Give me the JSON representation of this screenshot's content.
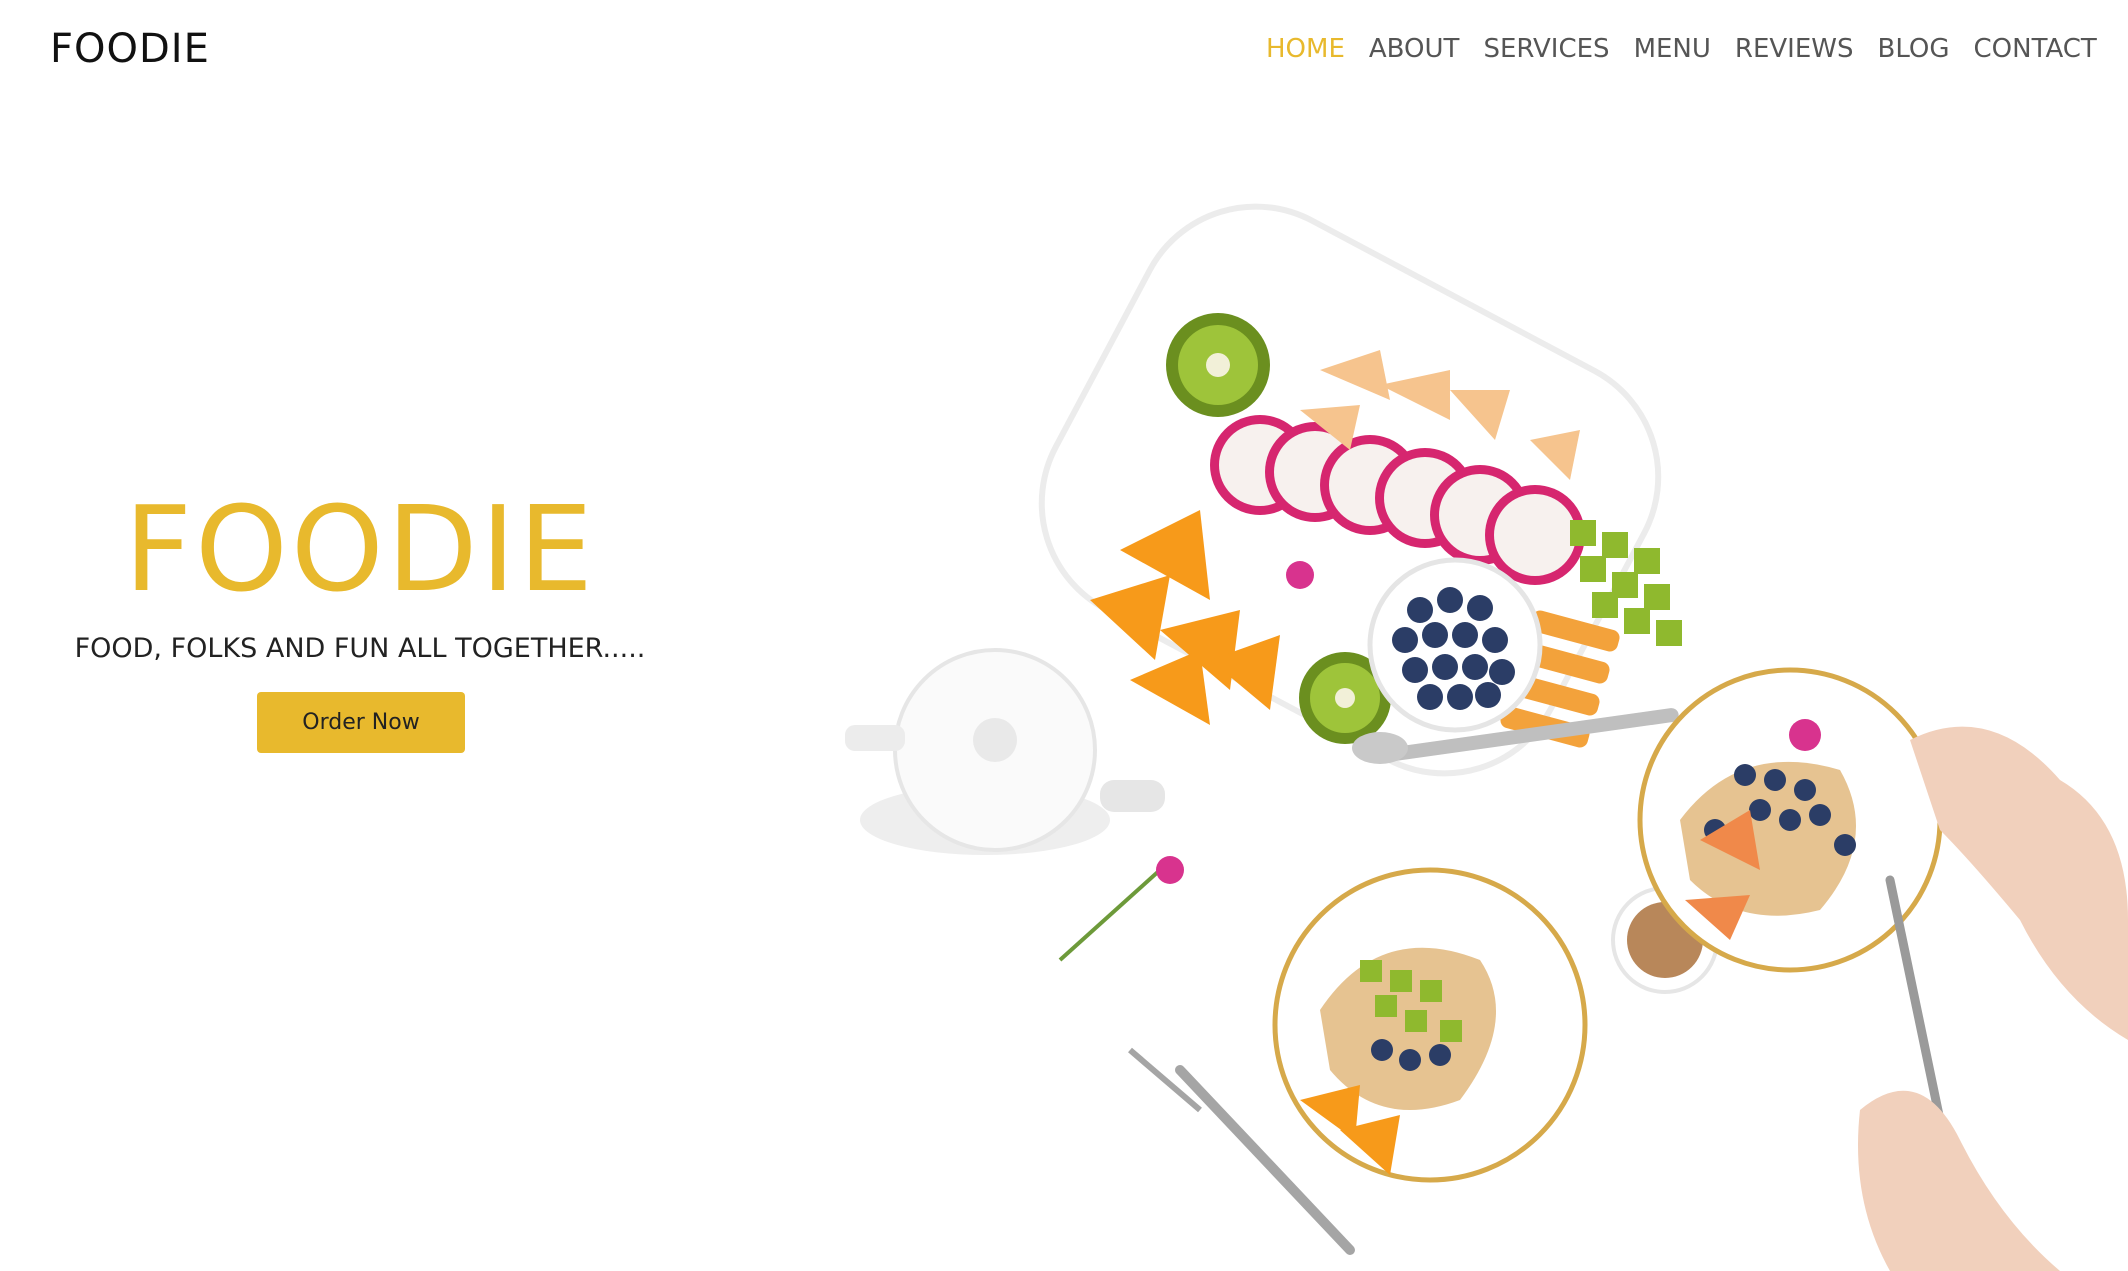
{
  "brand": "FOODIE",
  "nav": {
    "items": [
      "HOME",
      "ABOUT",
      "SERVICES",
      "MENU",
      "REVIEWS",
      "BLOG",
      "CONTACT"
    ],
    "active": "HOME"
  },
  "hero": {
    "title": "FOODIE",
    "subtitle": "FOOD, FOLKS AND FUN ALL TOGETHER.....",
    "cta": "Order Now"
  },
  "colors": {
    "accent": "#e8b92d",
    "text": "#222222",
    "nav_text": "#555555"
  },
  "image": {
    "subject": "breakfast-table-photo"
  }
}
